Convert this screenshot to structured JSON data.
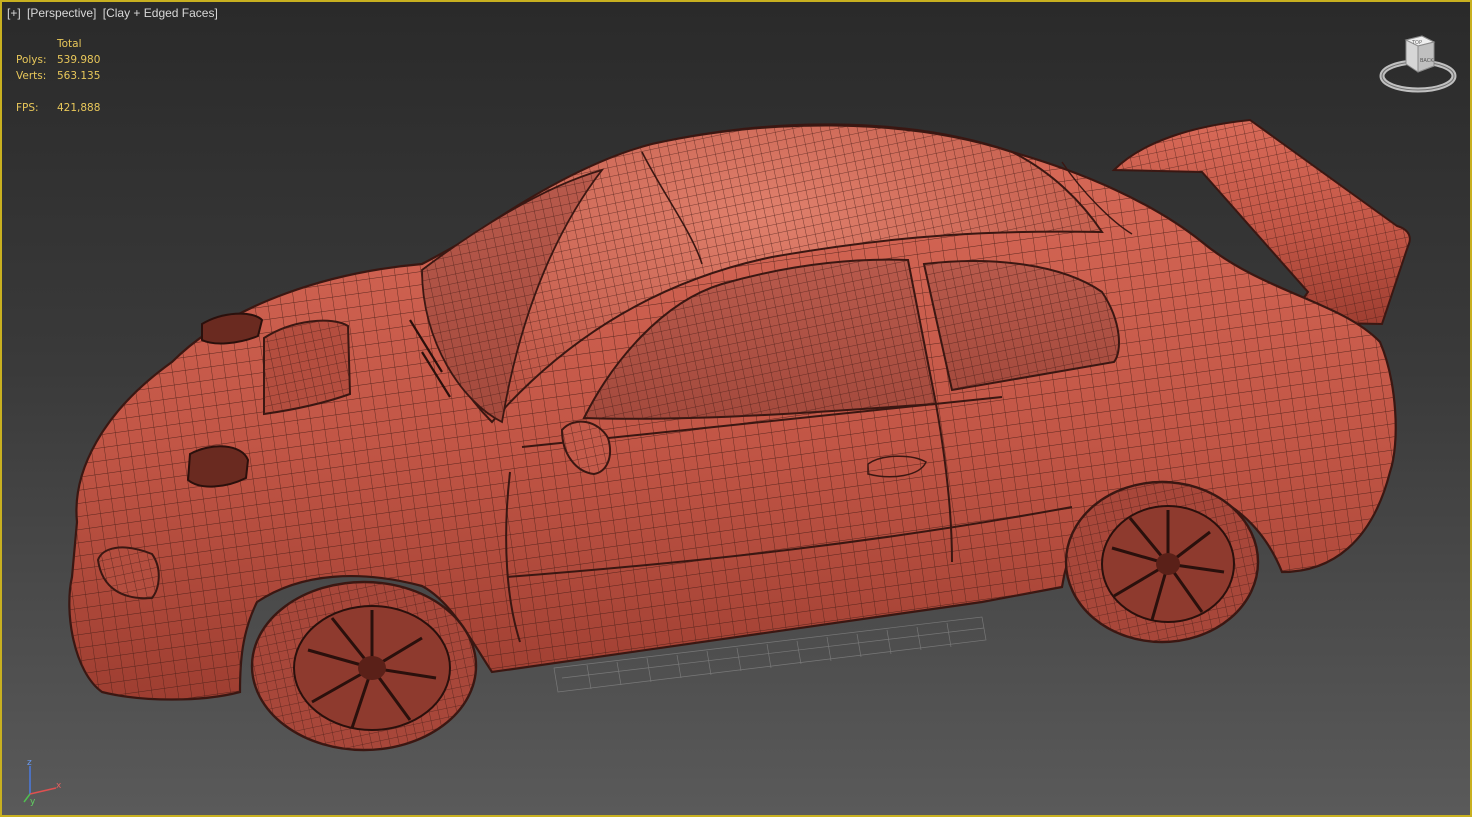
{
  "viewport": {
    "label_menu": "[+]",
    "label_view": "[Perspective]",
    "label_shading": "[Clay + Edged Faces]"
  },
  "stats": {
    "header": "Total",
    "polys_label": "Polys:",
    "polys_value": "539.980",
    "verts_label": "Verts:",
    "verts_value": "563.135",
    "fps_label": "FPS:",
    "fps_value": "421,888"
  },
  "viewcube": {
    "face_label": "BACK",
    "top_label": "TOP"
  },
  "axis": {
    "z": "z",
    "x": "x",
    "y": "y"
  },
  "colors": {
    "frame": "#c8b020",
    "stats_text": "#e8c75a",
    "clay": "#c45a4a",
    "edges": "#4a1f18"
  },
  "icons": {
    "viewcube": "viewcube-icon",
    "axis": "axis-tripod-icon"
  }
}
